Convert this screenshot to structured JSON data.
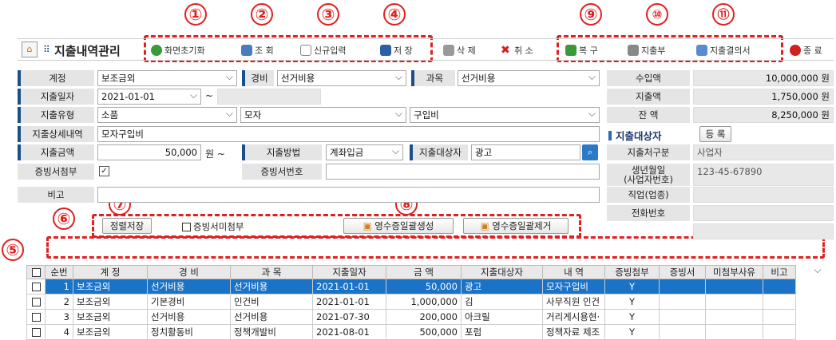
{
  "markers": [
    "①",
    "②",
    "③",
    "④",
    "⑤",
    "⑥",
    "⑦",
    "⑧",
    "⑨",
    "⑩",
    "⑪"
  ],
  "title": "지출내역관리",
  "toolbar": {
    "reset": "화면초기화",
    "search": "조 회",
    "new_entry": "신규입력",
    "save": "저 장",
    "delete": "삭 제",
    "cancel": "취 소",
    "restore": "복 구",
    "ledger": "지출부",
    "resolution": "지출결의서",
    "exit": "종 료"
  },
  "form": {
    "account_label": "계정",
    "account_value": "보조금외",
    "expense_label": "경비",
    "expense_value": "선거비용",
    "subject_label": "과목",
    "subject_value": "선거비용",
    "income_label": "수입액",
    "income_value": "10,000,000 원",
    "date_label": "지출일자",
    "date_value": "2021-01-01",
    "date_sep": "~",
    "spent_label": "지출액",
    "spent_value": "1,750,000 원",
    "type_label": "지출유형",
    "type_value1": "소품",
    "type_value2": "모자",
    "type_value3": "구입비",
    "balance_label": "잔 액",
    "balance_value": "8,250,000 원",
    "detail_label": "지출상세내역",
    "detail_value": "모자구입비",
    "payee_section": "지출대상자",
    "register_button": "등 록",
    "amount_label": "지출금액",
    "amount_value": "50,000",
    "amount_unit": "원 ~",
    "method_label": "지출방법",
    "method_value": "계좌입금",
    "target_label": "지출대상자",
    "target_value": "광고",
    "payee_type_label": "지출처구분",
    "payee_type_value": "사업자",
    "proof_label": "증빙서첨부",
    "proof_no_label": "증빙서번호",
    "birth_label": "생년월일\n(사업자번호)",
    "birth_value": "123-45-67890",
    "note_label": "비고",
    "job_label": "직업(업종)",
    "phone_label": "전화번호"
  },
  "actions": {
    "sort_save": "정렬저장",
    "no_proof": "증빙서미첨부",
    "receipt_create": "영수증일괄생성",
    "receipt_remove": "영수증일괄제거"
  },
  "table": {
    "headers": [
      "순번",
      "계 정",
      "경 비",
      "과 목",
      "지출일자",
      "금 액",
      "지출대상자",
      "내 역",
      "증빙첨부",
      "증빙서",
      "미첨부사유",
      "비고"
    ],
    "rows": [
      [
        "1",
        "보조금외",
        "선거비용",
        "선거비용",
        "2021-01-01",
        "50,000",
        "광고",
        "모자구입비",
        "Y",
        "",
        "",
        ""
      ],
      [
        "2",
        "보조금외",
        "기본경비",
        "인건비",
        "2021-01-01",
        "1,000,000",
        "김",
        "사무직원 인건",
        "Y",
        "",
        "",
        ""
      ],
      [
        "3",
        "보조금외",
        "선거비용",
        "선거비용",
        "2021-07-30",
        "200,000",
        "아크릴",
        "거리게시용현·",
        "Y",
        "",
        "",
        ""
      ],
      [
        "4",
        "보조금외",
        "정치활동비",
        "정책개발비",
        "2021-08-01",
        "500,000",
        "포럼",
        "정책자료 제조",
        "Y",
        "",
        "",
        ""
      ]
    ]
  }
}
